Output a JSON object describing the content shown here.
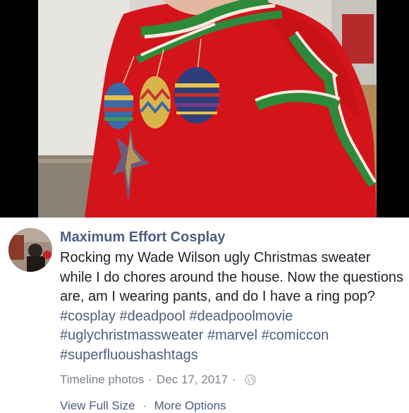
{
  "post": {
    "author": "Maximum Effort Cosplay",
    "message_text": "Rocking my Wade Wilson ugly Christmas sweater while I do chores around the house. Now the questions are, am I wearing pants, and do I have a ring pop?",
    "hashtags": [
      "#cosplay",
      "#deadpool",
      "#deadpoolmovie",
      "#uglychristmassweater",
      "#marvel",
      "#comiccon",
      "#superfluoushashtags"
    ],
    "album": "Timeline photos",
    "date": "Dec 17, 2017",
    "separator": "·",
    "privacy_icon": "globe-icon",
    "links": {
      "view_full_size": "View Full Size",
      "more_options": "More Options"
    }
  },
  "photo": {
    "subject": "red-christmas-sweater-photo",
    "colors": {
      "sweater": "#d4141b",
      "holly": "#2d8a3a",
      "trim": "#f4ece0",
      "background": "#000000"
    }
  },
  "colors": {
    "name": "#4b5f80",
    "text": "#1d2129",
    "meta": "#7b818c",
    "link": "#4b5f80"
  }
}
